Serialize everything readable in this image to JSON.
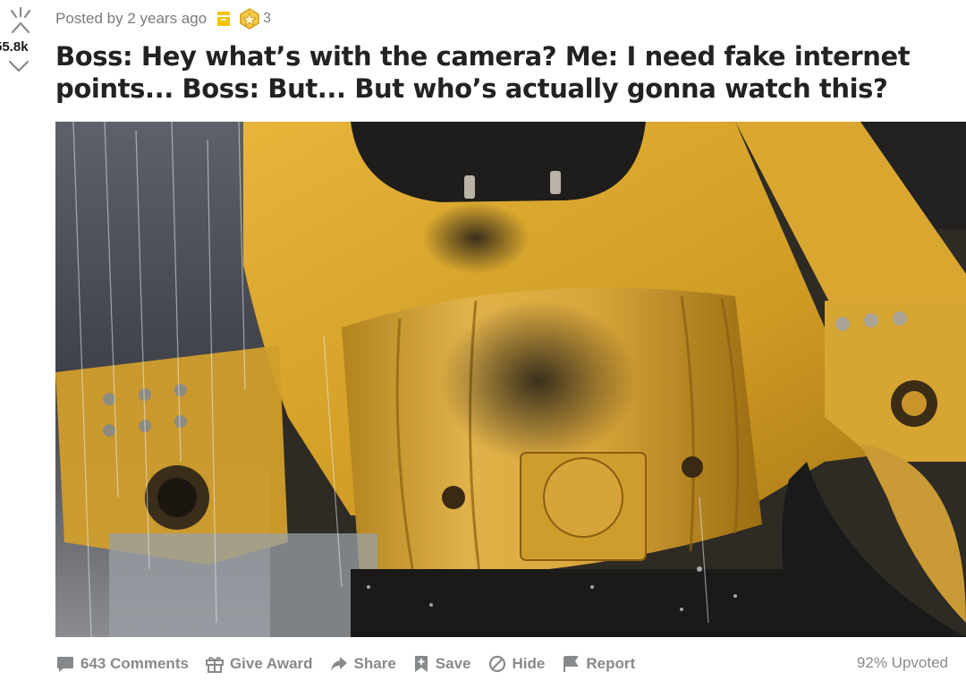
{
  "post": {
    "score": "55.8k",
    "meta": "Posted by 2 years ago",
    "award_count": "3",
    "title": "Boss: Hey what’s with the camera? Me: I need fake internet points... Boss: But... But who’s actually gonna watch this?",
    "image_alt": "Close-up photo of a dirty yellow heavy machinery joint with a mounted camera under spraying water"
  },
  "actions": {
    "comments": "643 Comments",
    "give_award": "Give Award",
    "share": "Share",
    "save": "Save",
    "hide": "Hide",
    "report": "Report"
  },
  "upvoted": "92% Upvoted",
  "colors": {
    "muted": "#878a8c",
    "machine_yellow": "#d8a72a",
    "award_gold": "#f5c400"
  },
  "icons": [
    "upvote-icon",
    "downvote-icon",
    "gold-award-icon",
    "badge-award-icon",
    "comment-icon",
    "gift-icon",
    "share-icon",
    "save-icon",
    "hide-icon",
    "report-icon"
  ]
}
